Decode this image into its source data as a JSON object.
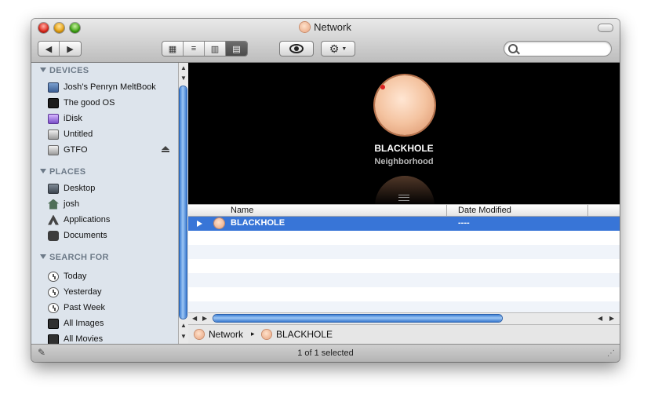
{
  "window": {
    "title": "Network"
  },
  "toolbar": {
    "back_icon": "◀",
    "forward_icon": "▶",
    "view_icons": "☷ ≡ ▥ ▤",
    "quicklook_icon": "eye-icon",
    "action_icon": "gear-icon",
    "search_placeholder": ""
  },
  "sidebar": {
    "devices_label": "DEVICES",
    "devices": [
      {
        "label": "Josh’s Penryn MeltBook",
        "icon": "laptop-icon"
      },
      {
        "label": "The good OS",
        "icon": "disk-icon"
      },
      {
        "label": "iDisk",
        "icon": "idisk-icon"
      },
      {
        "label": "Untitled",
        "icon": "drive-icon"
      },
      {
        "label": "GTFO",
        "icon": "drive-icon"
      }
    ],
    "places_label": "PLACES",
    "places": [
      {
        "label": "Desktop",
        "icon": "desktop-icon"
      },
      {
        "label": "josh",
        "icon": "home-icon"
      },
      {
        "label": "Applications",
        "icon": "applications-icon"
      },
      {
        "label": "Documents",
        "icon": "documents-icon"
      }
    ],
    "search_label": "SEARCH FOR",
    "searches": [
      {
        "label": "Today",
        "icon": "clock-icon"
      },
      {
        "label": "Yesterday",
        "icon": "clock-icon"
      },
      {
        "label": "Past Week",
        "icon": "clock-icon"
      },
      {
        "label": "All Images",
        "icon": "images-icon"
      },
      {
        "label": "All Movies",
        "icon": "movies-icon"
      }
    ]
  },
  "coverflow": {
    "name": "BLACKHOLE",
    "subtitle": "Neighborhood"
  },
  "list": {
    "headers": {
      "name": "Name",
      "date": "Date Modified"
    },
    "rows": [
      {
        "name": "BLACKHOLE",
        "date": "----"
      }
    ]
  },
  "pathbar": {
    "items": [
      "Network",
      "BLACKHOLE"
    ],
    "separator": "▸"
  },
  "status": {
    "text": "1 of 1 selected"
  },
  "colors": {
    "selection": "#3875d7",
    "sidebar": "#dde4ec",
    "scroll_thumb": "#3d7fd6"
  }
}
